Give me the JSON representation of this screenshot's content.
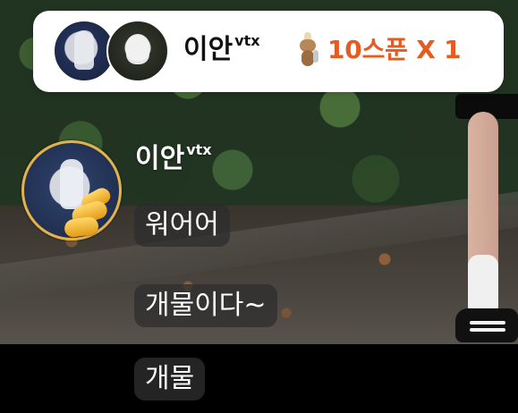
{
  "top_card": {
    "username": "이안",
    "username_suffix": "vtx",
    "reward_text": "10스푼 X 1",
    "reward_icon": "rabbit-spoon-icon",
    "accent_color": "#e65b1f"
  },
  "chat": {
    "sender": {
      "name": "이안",
      "name_suffix": "vtx",
      "badge_icon": "gold-wing-badge-icon",
      "ring_color": "#e4b24a"
    },
    "messages": [
      {
        "text": "워어어"
      },
      {
        "text": "개물이다~"
      },
      {
        "text": "개물"
      }
    ]
  }
}
